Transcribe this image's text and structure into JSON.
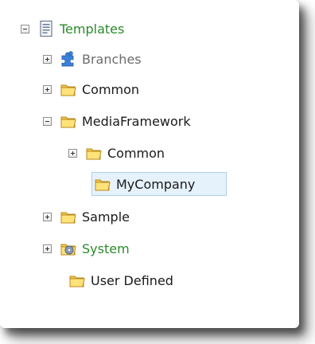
{
  "tree": {
    "root": {
      "label": "Templates",
      "expanded": true,
      "icon": "template-icon",
      "color": "#2b8a2b"
    },
    "items": [
      {
        "label": "Branches",
        "icon": "puzzle-icon",
        "toggle": "plus",
        "color": "#6b6b6b"
      },
      {
        "label": "Common",
        "icon": "folder-icon",
        "toggle": "plus"
      },
      {
        "label": "MediaFramework",
        "icon": "folder-icon",
        "toggle": "minus"
      },
      {
        "label": "Common",
        "icon": "folder-icon",
        "toggle": "plus"
      },
      {
        "label": "MyCompany",
        "icon": "folder-icon",
        "toggle": "none",
        "selected": true
      },
      {
        "label": "Sample",
        "icon": "folder-icon",
        "toggle": "plus"
      },
      {
        "label": "System",
        "icon": "gear-folder-icon",
        "toggle": "plus",
        "color": "#2b8a2b"
      },
      {
        "label": "User Defined",
        "icon": "folder-icon",
        "toggle": "none"
      }
    ]
  },
  "colors": {
    "selection_bg": "#e6f2fb",
    "selection_border": "#a9cfee",
    "folder": "#f2c94c",
    "green_text": "#2b8a2b"
  }
}
